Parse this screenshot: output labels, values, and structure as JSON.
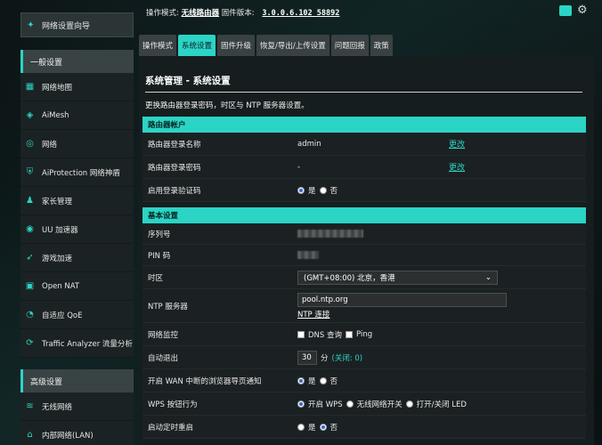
{
  "topbar": {
    "mode_label": "操作模式:",
    "mode_value": "无线路由器",
    "fw_label": "固件版本:",
    "fw_value": "3.0.0.6.102_58892"
  },
  "sidebar": {
    "wizard": "网络设置向导",
    "general_header": "一般设置",
    "general_items": [
      {
        "label": "网络地图",
        "icon": "map-icon"
      },
      {
        "label": "AiMesh",
        "icon": "mesh-icon"
      },
      {
        "label": "网络",
        "icon": "globe-icon"
      },
      {
        "label": "AiProtection 网络神盾",
        "icon": "shield-icon"
      },
      {
        "label": "家长管理",
        "icon": "parent-icon"
      },
      {
        "label": "UU 加速器",
        "icon": "uu-icon"
      },
      {
        "label": "游戏加速",
        "icon": "rocket-icon"
      },
      {
        "label": "Open NAT",
        "icon": "nat-icon"
      },
      {
        "label": "自适应 QoE",
        "icon": "qos-icon"
      },
      {
        "label": "Traffic Analyzer 流量分析",
        "icon": "traffic-icon"
      }
    ],
    "advanced_header": "高级设置",
    "advanced_items": [
      {
        "label": "无线网络",
        "icon": "wifi-icon"
      },
      {
        "label": "内部网络(LAN)",
        "icon": "lan-icon"
      }
    ]
  },
  "tabs": [
    "操作模式",
    "系统设置",
    "固件升级",
    "恢复/导出/上传设置",
    "问题回报",
    "政策"
  ],
  "page": {
    "title": "系统管理 - 系统设置",
    "description": "更换路由器登录密码，时区与 NTP 服务器设置。"
  },
  "account": {
    "header": "路由器帐户",
    "login_name_label": "路由器登录名称",
    "login_name_value": "admin",
    "login_pw_label": "路由器登录密码",
    "login_pw_value": "-",
    "change_link": "更改",
    "captcha_label": "启用登录验证码",
    "yes": "是",
    "no": "否"
  },
  "basic": {
    "header": "基本设置",
    "serial_label": "序列号",
    "pin_label": "PIN 码",
    "tz_label": "时区",
    "tz_value": "(GMT+08:00) 北京，香港",
    "ntp_label": "NTP 服务器",
    "ntp_value": "pool.ntp.org",
    "ntp_link": "NTP 连接",
    "monitor_label": "网络监控",
    "dns_query": "DNS 查询",
    "ping": "Ping",
    "logout_label": "自动退出",
    "logout_value": "30",
    "logout_unit": "分",
    "logout_note": "(关闭: 0)",
    "wan_notify_label": "开启 WAN 中断的浏览器导页通知",
    "wps_label": "WPS 按钮行为",
    "wps_opt1": "开启 WPS",
    "wps_opt2": "无线网络开关",
    "wps_opt3": "打开/关闭 LED",
    "reboot_label": "启动定时重启",
    "yes": "是",
    "no": "否"
  }
}
